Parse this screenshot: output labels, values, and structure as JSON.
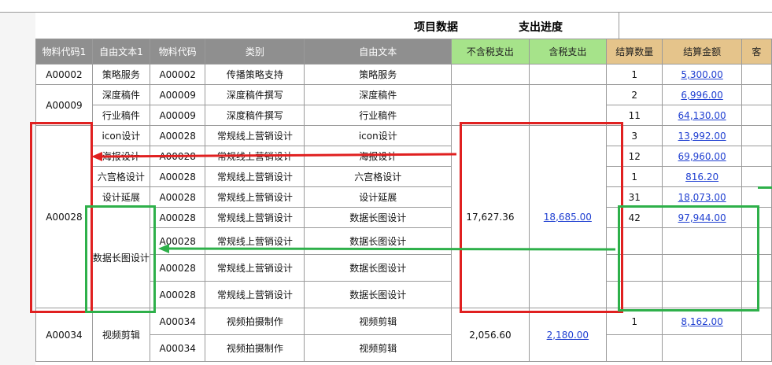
{
  "header": {
    "title_project": "项目数据",
    "title_progress": "支出进度"
  },
  "columns": [
    "物料代码1",
    "自由文本1",
    "物料代码",
    "类别",
    "自由文本",
    "不含税支出",
    "含税支出",
    "结算数量",
    "结算金额",
    "客"
  ],
  "rows": [
    {
      "code": "A00002",
      "cat": "传播策略支持",
      "text": "策略服务",
      "qty": "1",
      "amt": "5,300.00",
      "free1": "策略服务"
    },
    {
      "code": "A00009",
      "cat": "深度稿件撰写",
      "text": "深度稿件",
      "qty": "2",
      "amt": "6,996.00",
      "free1": "深度稿件"
    },
    {
      "code": "A00009",
      "cat": "深度稿件撰写",
      "text": "行业稿件",
      "qty": "11",
      "amt": "64,130.00",
      "free1": "行业稿件"
    },
    {
      "code": "A00028",
      "cat": "常规线上营销设计",
      "text": "icon设计",
      "qty": "3",
      "amt": "13,992.00",
      "free1": "icon设计"
    },
    {
      "code": "A00028",
      "cat": "常规线上营销设计",
      "text": "海报设计",
      "qty": "12",
      "amt": "69,960.00",
      "free1": "海报设计"
    },
    {
      "code": "A00028",
      "cat": "常规线上营销设计",
      "text": "六宫格设计",
      "qty": "1",
      "amt": "816.20",
      "free1": "六宫格设计"
    },
    {
      "code": "A00028",
      "cat": "常规线上营销设计",
      "text": "设计延展",
      "qty": "31",
      "amt": "18,073.00",
      "free1": "设计延展"
    },
    {
      "code": "A00028",
      "cat": "常规线上营销设计",
      "text": "数据长图设计",
      "qty": "42",
      "amt": "97,944.00",
      "free1": ""
    },
    {
      "code": "A00028",
      "cat": "常规线上营销设计",
      "text": "数据长图设计",
      "qty": "",
      "amt": "",
      "free1": ""
    },
    {
      "code": "A00028",
      "cat": "常规线上营销设计",
      "text": "数据长图设计",
      "qty": "",
      "amt": "",
      "free1": ""
    },
    {
      "code": "A00028",
      "cat": "常规线上营销设计",
      "text": "数据长图设计",
      "qty": "",
      "amt": "",
      "free1": ""
    },
    {
      "code": "A00034",
      "cat": "视频拍摄制作",
      "text": "视频剪辑",
      "qty": "1",
      "amt": "8,162.00",
      "free1": ""
    },
    {
      "code": "A00034",
      "cat": "视频拍摄制作",
      "text": "视频剪辑",
      "qty": "",
      "amt": "",
      "free1": ""
    }
  ],
  "merged": {
    "code1_a00002": "A00002",
    "code1_a00009": "A00009",
    "code1_a00028": "A00028",
    "code1_a00034": "A00034",
    "free1_datalong": "数据长图设计",
    "free1_video": "视频剪辑",
    "a00028_notax": "17,627.36",
    "a00028_tax": "18,685.00",
    "a00034_notax": "2,056.60",
    "a00034_tax": "2,180.00"
  },
  "colors": {
    "red_annotation": "#e02020",
    "green_annotation": "#2eb04a",
    "header_gray": "#8f8f8f",
    "header_green": "#a6e38a",
    "header_tan": "#e5c48b",
    "link_blue": "#1f3fd1"
  }
}
